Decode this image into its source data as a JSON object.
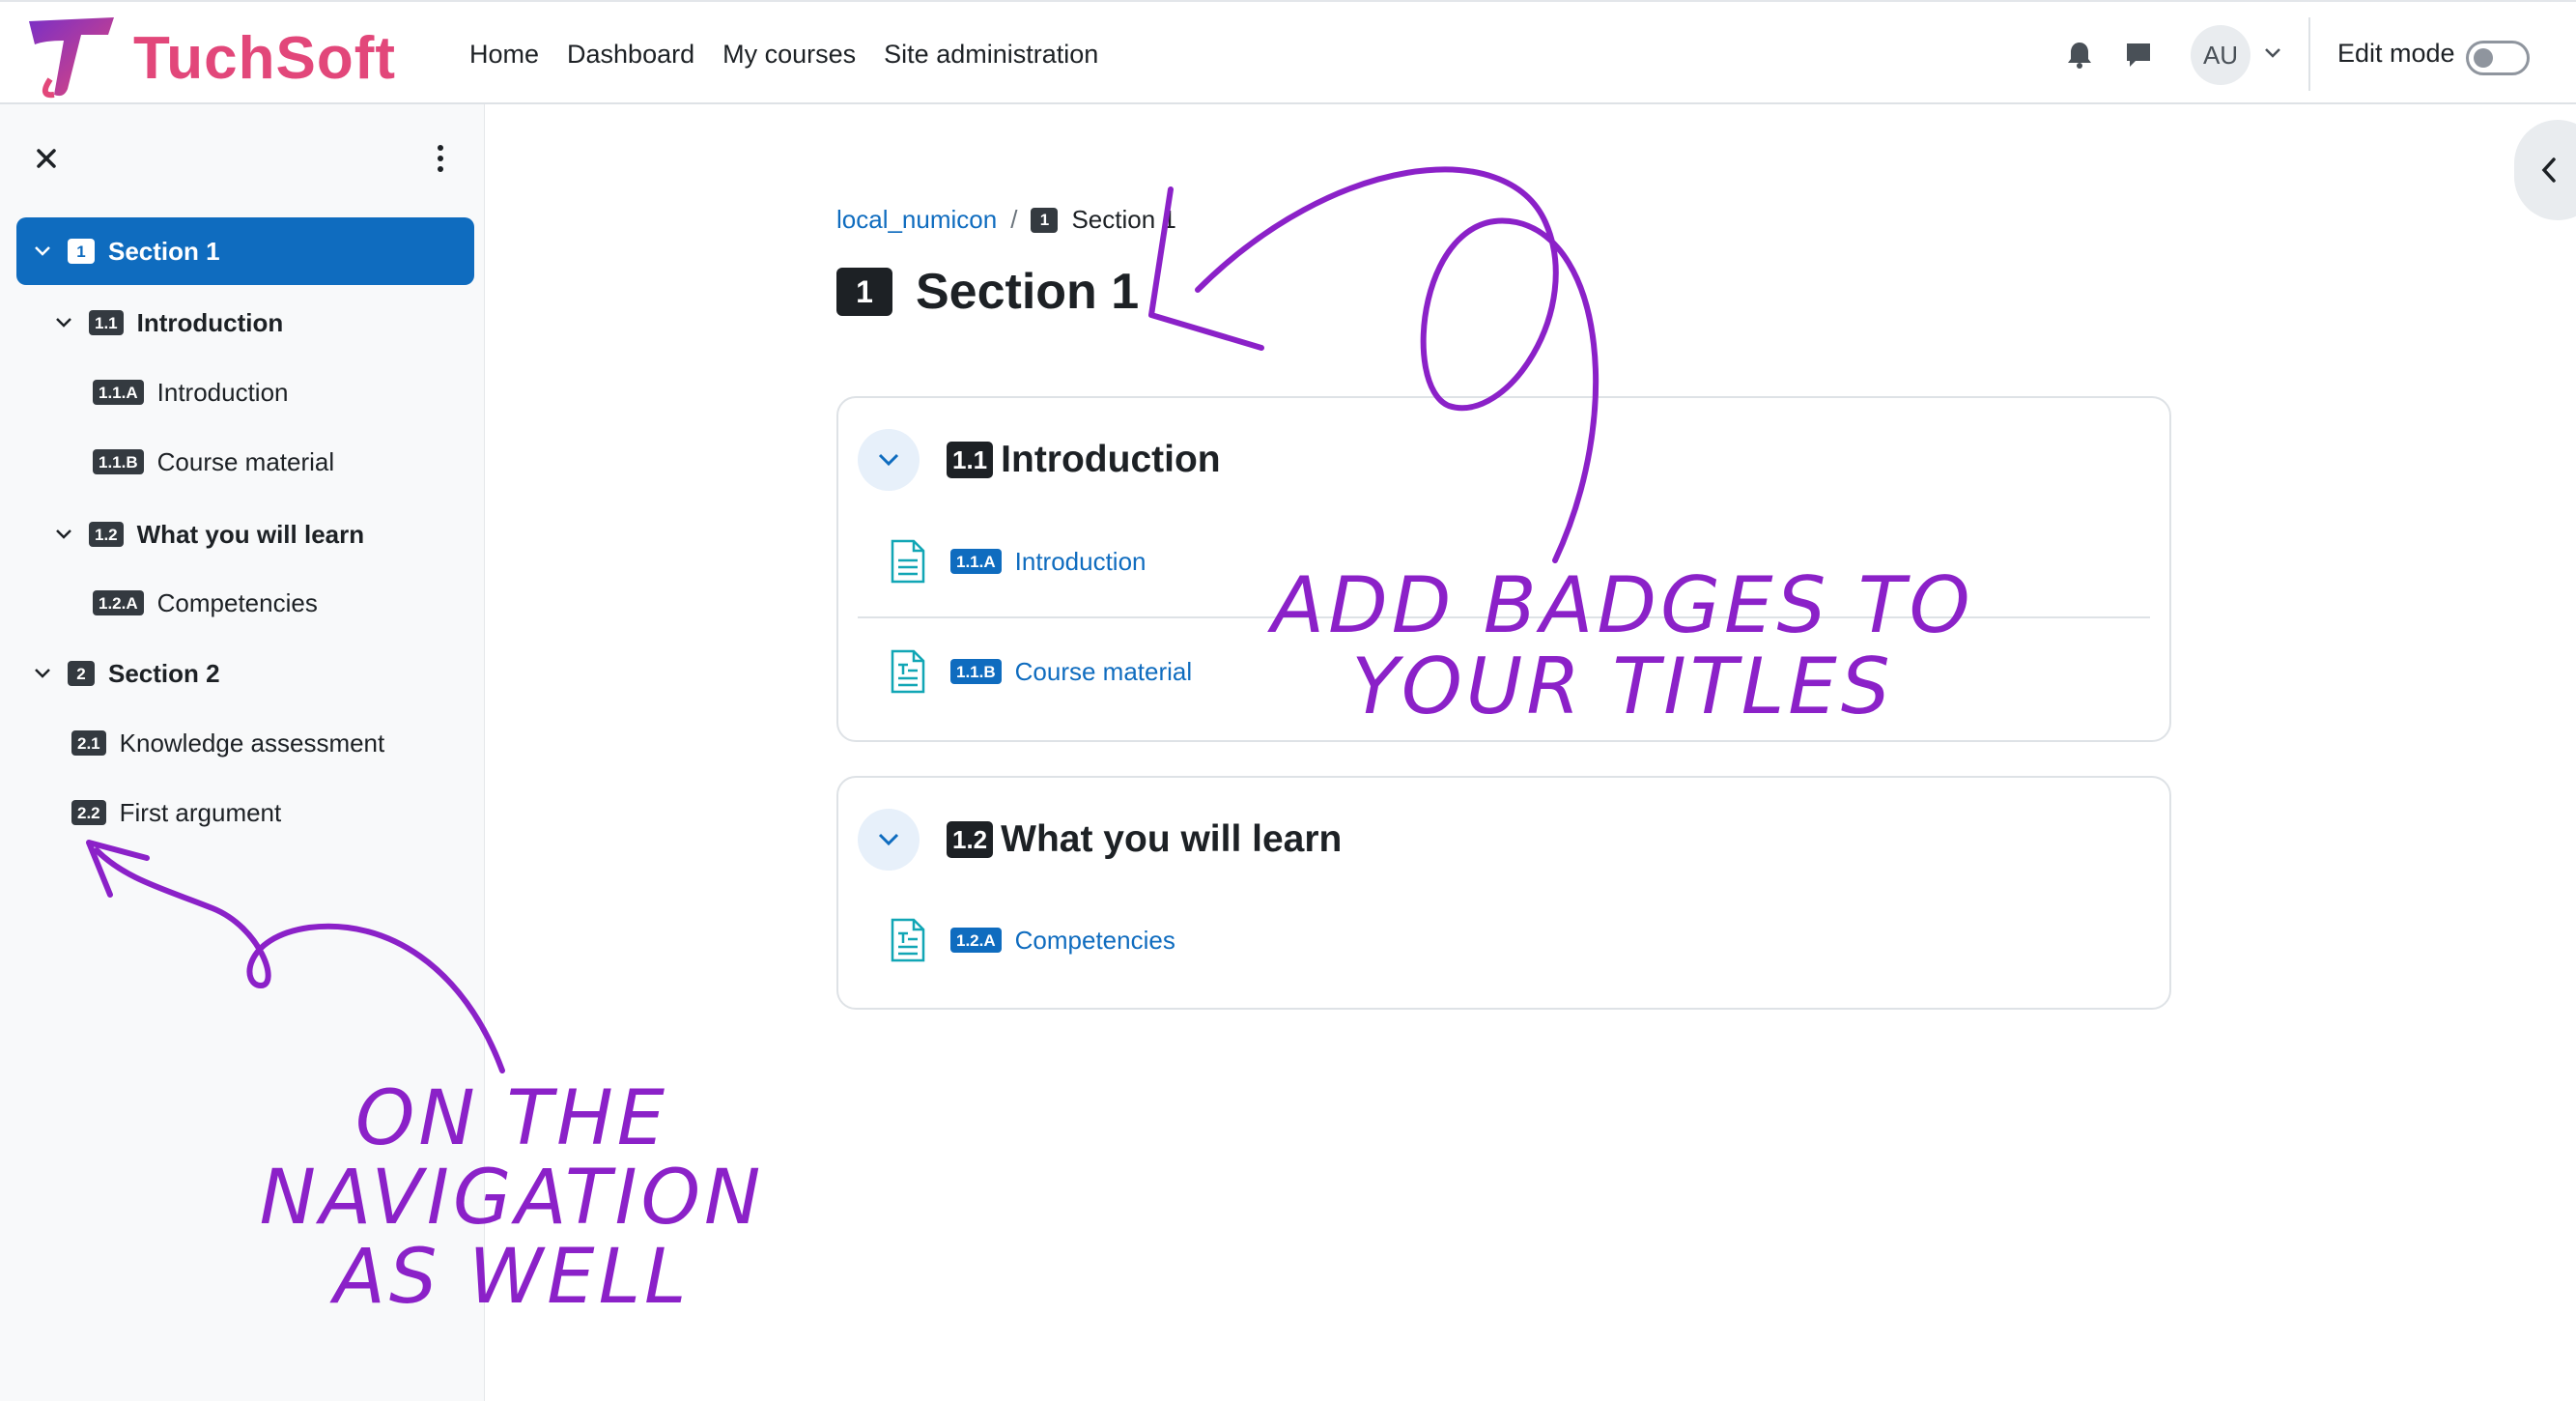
{
  "brand": {
    "name": "TuchSoft",
    "colors": {
      "primary": "#0f6cbf",
      "logo_pink": "#e2477a",
      "logo_purple": "#7a2fc6",
      "annotation": "#8b21c8"
    }
  },
  "navbar": {
    "links": [
      "Home",
      "Dashboard",
      "My courses",
      "Site administration"
    ],
    "notification_icon": "bell-icon",
    "messages_icon": "chat-icon",
    "user_initials": "AU",
    "edit_mode_label": "Edit mode",
    "edit_mode_on": false
  },
  "drawer": {
    "close_icon": "close-icon",
    "menu_icon": "kebab-icon",
    "items": [
      {
        "badge": "1",
        "label": "Section 1",
        "level": 0,
        "active": true,
        "expanded": true,
        "bold": true
      },
      {
        "badge": "1.1",
        "label": "Introduction",
        "level": 1,
        "active": false,
        "expanded": true,
        "bold": true
      },
      {
        "badge": "1.1.A",
        "label": "Introduction",
        "level": 2,
        "active": false,
        "bold": false
      },
      {
        "badge": "1.1.B",
        "label": "Course material",
        "level": 2,
        "active": false,
        "bold": false
      },
      {
        "badge": "1.2",
        "label": "What you will learn",
        "level": 1,
        "active": false,
        "expanded": true,
        "bold": true
      },
      {
        "badge": "1.2.A",
        "label": "Competencies",
        "level": 2,
        "active": false,
        "bold": false
      },
      {
        "badge": "2",
        "label": "Section 2",
        "level": 0,
        "active": false,
        "expanded": true,
        "bold": true
      },
      {
        "badge": "2.1",
        "label": "Knowledge assessment",
        "level": 1,
        "active": false,
        "bold": false
      },
      {
        "badge": "2.2",
        "label": "First argument",
        "level": 1,
        "active": false,
        "bold": false
      }
    ]
  },
  "breadcrumb": {
    "course": "local_numicon",
    "separator": "/",
    "current_badge": "1",
    "current": "Section 1"
  },
  "page": {
    "title_badge": "1",
    "title": "Section 1"
  },
  "cards": [
    {
      "badge": "1.1",
      "title": "Introduction",
      "activities": [
        {
          "badge": "1.1.A",
          "label": "Introduction",
          "icon": "page-icon"
        },
        {
          "badge": "1.1.B",
          "label": "Course material",
          "icon": "book-icon"
        }
      ]
    },
    {
      "badge": "1.2",
      "title": "What you will learn",
      "activities": [
        {
          "badge": "1.2.A",
          "label": "Competencies",
          "icon": "book-icon"
        }
      ]
    }
  ],
  "annotations": {
    "top_line1": "ADD BADGES TO",
    "top_line2": "YOUR TITLES",
    "bottom_line1": "ON THE",
    "bottom_line2": "NAVIGATION",
    "bottom_line3": "AS WELL"
  },
  "right_drawer_icon": "chevron-left-icon"
}
